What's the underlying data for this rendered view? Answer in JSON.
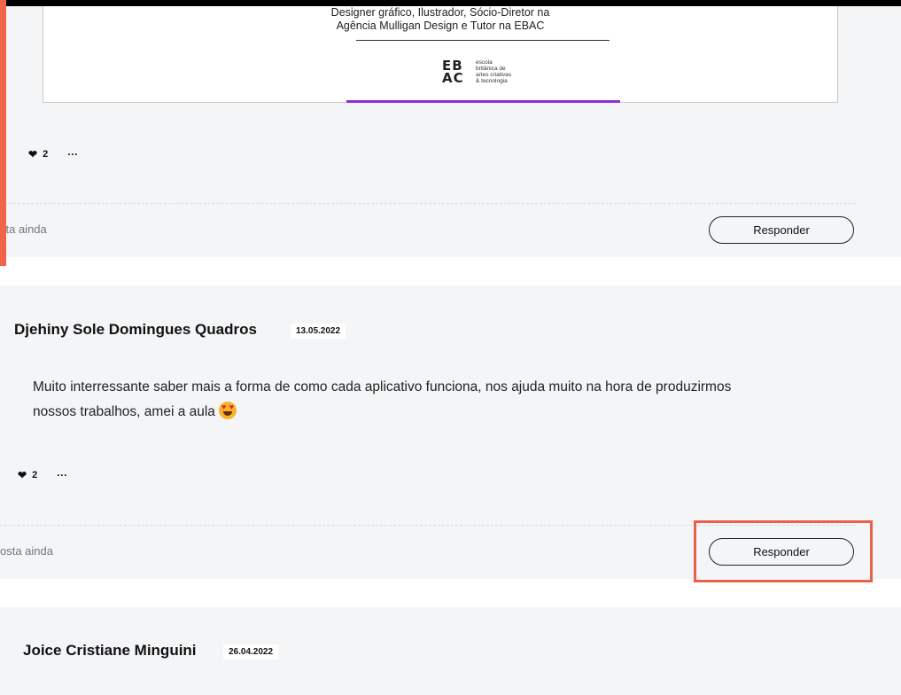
{
  "post1": {
    "image_caption_line1": "Designer gráfico, Ilustrador, Sócio-Diretor na",
    "image_caption_line2": "Agência Mulligan Design e Tutor na EBAC",
    "logo_mark": "EBAC",
    "logo_text": [
      "escola",
      "britânica de",
      "artes criativas",
      "& tecnologia"
    ],
    "likes": "2",
    "more": "···",
    "no_reply_text": "sta ainda",
    "reply_button": "Responder"
  },
  "post2": {
    "author": "Djehiny Sole Domingues Quadros",
    "date": "13.05.2022",
    "comment_line1": "Muito interressante saber mais a forma de como cada aplicativo funciona, nos ajuda muito na hora de produzirmos",
    "comment_line2": "nossos trabalhos, amei a aula",
    "likes": "2",
    "more": "···",
    "no_reply_text": "osta ainda",
    "reply_button": "Responder"
  },
  "post3": {
    "author": "Joice Cristiane Minguini",
    "date": "26.04.2022"
  },
  "colors": {
    "accent": "#f0644c",
    "highlight": "#ec5f48",
    "progress": "#8f2fd6",
    "card_bg": "#f4f5f7"
  },
  "icons": [
    "heart-icon",
    "more-options-icon",
    "heart-eyes-emoji"
  ]
}
